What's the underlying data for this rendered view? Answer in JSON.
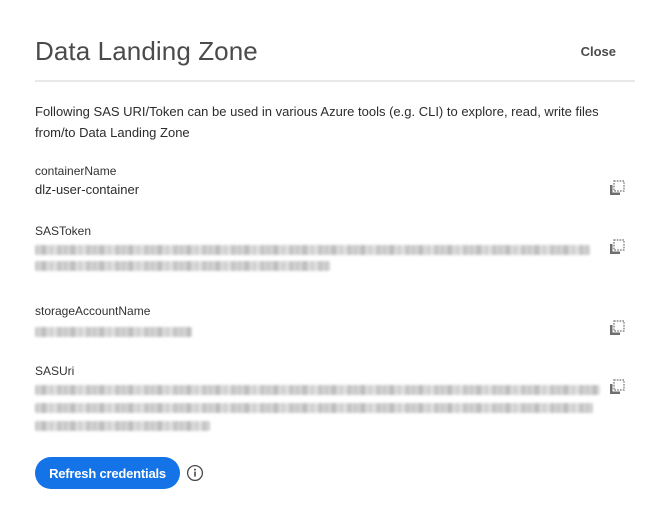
{
  "dialog": {
    "title": "Data Landing Zone",
    "close_label": "Close",
    "description": "Following SAS URI/Token can be used in various Azure tools (e.g. CLI) to explore, read, write files from/to Data Landing Zone"
  },
  "fields": {
    "container": {
      "label": "containerName",
      "value": "dlz-user-container",
      "copy_icon": "copy-icon"
    },
    "sas_token": {
      "label": "SASToken",
      "value_state": "redacted",
      "copy_icon": "copy-icon"
    },
    "storage_account": {
      "label": "storageAccountName",
      "value_state": "redacted",
      "copy_icon": "copy-icon"
    },
    "sas_uri": {
      "label": "SASUri",
      "value_state": "redacted",
      "copy_icon": "copy-icon"
    }
  },
  "footer": {
    "refresh_label": "Refresh credentials",
    "info_icon": "info-icon"
  },
  "colors": {
    "accent": "#1473e6",
    "divider": "#e8e8e8",
    "text": "#2c2c2c",
    "icon": "#6e6e6e"
  }
}
